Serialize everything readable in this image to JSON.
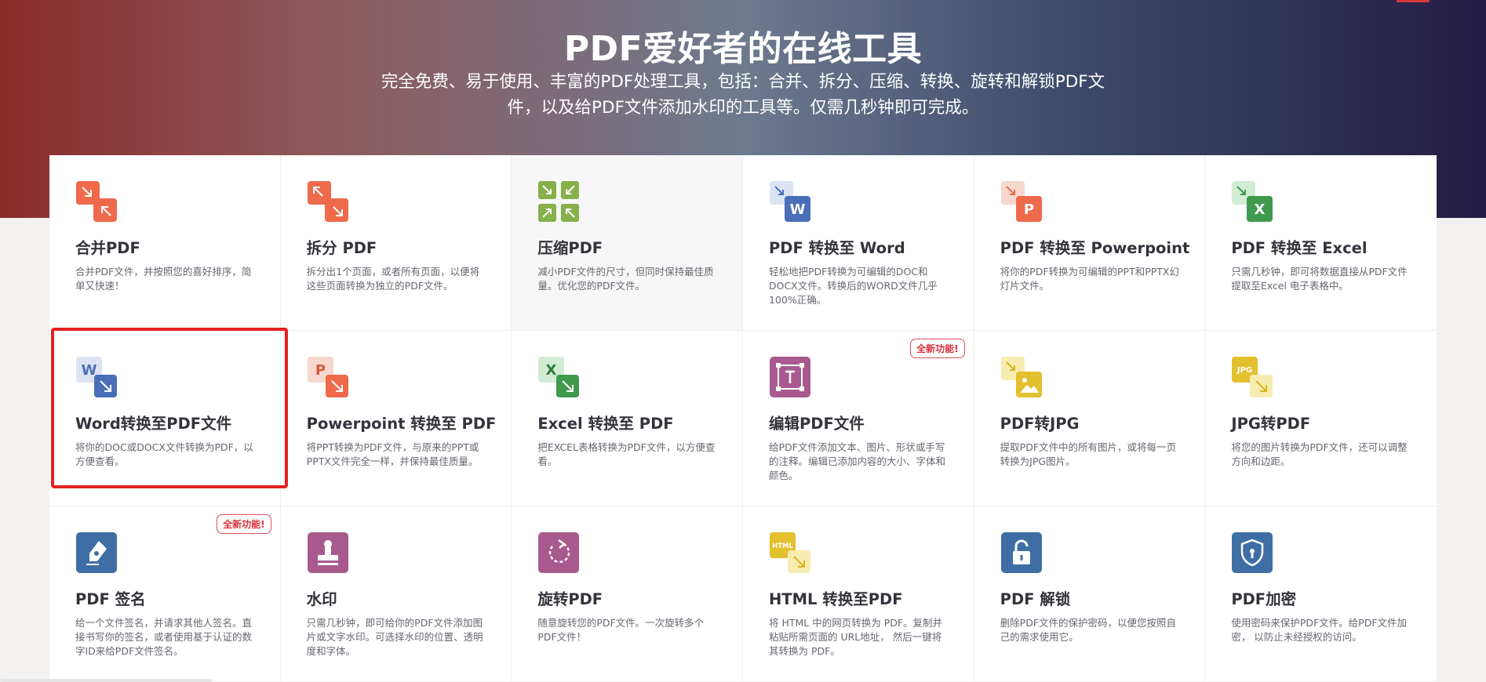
{
  "hero": {
    "title": "PDF爱好者的在线工具",
    "subtitle": "完全免费、易于使用、丰富的PDF处理工具，包括：合并、拆分、压缩、转换、旋转和解锁PDF文件，以及给PDF文件添加水印的工具等。仅需几秒钟即可完成。"
  },
  "badge_text": "全新功能!",
  "tools": [
    {
      "title": "合并PDF",
      "desc": "合并PDF文件，并按照您的喜好排序，简单又快速！",
      "icon": "merge-pdf-icon"
    },
    {
      "title": "拆分 PDF",
      "desc": "拆分出1个页面，或者所有页面，以便将这些页面转换为独立的PDF文件。",
      "icon": "split-pdf-icon"
    },
    {
      "title": "压缩PDF",
      "desc": "减小PDF文件的尺寸，但同时保持最佳质量。优化您的PDF文件。",
      "icon": "compress-pdf-icon"
    },
    {
      "title": "PDF 转换至 Word",
      "desc": "轻松地把PDF转换为可编辑的DOC和DOCX文件。转换后的WORD文件几乎100%正确。",
      "icon": "pdf-to-word-icon"
    },
    {
      "title": "PDF 转换至 Powerpoint",
      "desc": "将你的PDF转换为可编辑的PPT和PPTX幻灯片文件。",
      "icon": "pdf-to-powerpoint-icon"
    },
    {
      "title": "PDF 转换至 Excel",
      "desc": "只需几秒钟，即可将数据直接从PDF文件提取至Excel 电子表格中。",
      "icon": "pdf-to-excel-icon"
    },
    {
      "title": "Word转换至PDF文件",
      "desc": "将你的DOC或DOCX文件转换为PDF，以方便查看。",
      "icon": "word-to-pdf-icon"
    },
    {
      "title": "Powerpoint 转换至 PDF",
      "desc": "将PPT转换为PDF文件，与原来的PPT或PPTX文件完全一样，并保持最佳质量。",
      "icon": "powerpoint-to-pdf-icon"
    },
    {
      "title": "Excel 转换至 PDF",
      "desc": "把EXCEL表格转换为PDF文件，以方便查看。",
      "icon": "excel-to-pdf-icon"
    },
    {
      "title": "编辑PDF文件",
      "desc": "给PDF文件添加文本、图片、形状或手写的注释。编辑已添加内容的大小、字体和颜色。",
      "icon": "edit-pdf-icon",
      "badge": true
    },
    {
      "title": "PDF转JPG",
      "desc": "提取PDF文件中的所有图片，或将每一页转换为JPG图片。",
      "icon": "pdf-to-jpg-icon"
    },
    {
      "title": "JPG转PDF",
      "desc": "将您的图片转换为PDF文件，还可以调整方向和边距。",
      "icon": "jpg-to-pdf-icon"
    },
    {
      "title": "PDF 签名",
      "desc": "给一个文件签名，并请求其他人签名。直接书写你的签名，或者使用基于认证的数字ID来给PDF文件签名。",
      "icon": "sign-pdf-icon",
      "badge": true
    },
    {
      "title": "水印",
      "desc": "只需几秒钟，即可给你的PDF文件添加图片或文字水印。可选择水印的位置、透明度和字体。",
      "icon": "watermark-icon"
    },
    {
      "title": "旋转PDF",
      "desc": "随意旋转您的PDF文件。一次旋转多个PDF文件！",
      "icon": "rotate-pdf-icon"
    },
    {
      "title": "HTML 转换至PDF",
      "desc": "将 HTML 中的网页转换为 PDF。复制并粘贴所需页面的 URL地址， 然后一键将其转换为 PDF。",
      "icon": "html-to-pdf-icon"
    },
    {
      "title": "PDF 解锁",
      "desc": "删除PDF文件的保护密码，以便您按照自己的需求使用它。",
      "icon": "unlock-pdf-icon"
    },
    {
      "title": "PDF加密",
      "desc": "使用密码来保护PDF文件。给PDF文件加密， 以防止未经授权的访问。",
      "icon": "protect-pdf-icon"
    }
  ],
  "icon_labels": {
    "word": "W",
    "ppt": "P",
    "excel": "X",
    "jpg": "JPG",
    "html": "HTML"
  },
  "colors": {
    "orange": "#ee6a4b",
    "green": "#86b04a",
    "blue": "#4a6fb8",
    "excel_green": "#3f9a4e",
    "purple": "#a85a8e",
    "yellow": "#e2c02e",
    "steel_blue": "#3f6ea5",
    "highlight": "#e52020"
  }
}
